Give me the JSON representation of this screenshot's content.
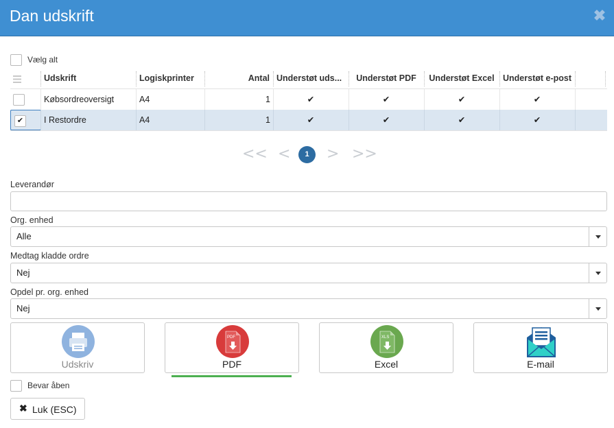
{
  "dialog": {
    "title": "Dan udskrift",
    "close_icon": "close-icon"
  },
  "select_all": {
    "label": "Vælg alt",
    "checked": false
  },
  "grid": {
    "columns": [
      "Udskrift",
      "Logiskprinter",
      "Antal",
      "Understøt uds...",
      "Understøt PDF",
      "Understøt Excel",
      "Understøt e-post"
    ],
    "rows": [
      {
        "checked": false,
        "name": "Købsordreoversigt",
        "printer": "A4",
        "count": "1",
        "uds": true,
        "pdf": true,
        "excel": true,
        "email": true
      },
      {
        "checked": true,
        "name": "I Restordre",
        "printer": "A4",
        "count": "1",
        "uds": true,
        "pdf": true,
        "excel": true,
        "email": true
      }
    ],
    "check_glyph": "✔",
    "row_checkbox_glyph": "✔",
    "column_menu_icon": "list-icon"
  },
  "pager": {
    "first": "<<",
    "prev": "<",
    "current": "1",
    "next": ">",
    "last": ">>"
  },
  "form": {
    "supplier": {
      "label": "Leverandør",
      "value": ""
    },
    "org_unit": {
      "label": "Org. enhed",
      "value": "Alle"
    },
    "draft_orders": {
      "label": "Medtag kladde ordre",
      "value": "Nej"
    },
    "split_org": {
      "label": "Opdel pr. org. enhed",
      "value": "Nej"
    }
  },
  "outputs": {
    "print": {
      "label": "Udskriv",
      "icon": "printer-icon",
      "color": "#8fb3df",
      "disabled": true
    },
    "pdf": {
      "label": "PDF",
      "icon": "pdf-file-icon",
      "color": "#d83b3b",
      "selected": true
    },
    "excel": {
      "label": "Excel",
      "icon": "excel-file-icon",
      "color": "#6aa84f"
    },
    "email": {
      "label": "E-mail",
      "icon": "envelope-icon",
      "color": "#1f5f9e"
    },
    "pdf_badge": "PDF",
    "xls_badge": "XLS"
  },
  "keep_open": {
    "label": "Bevar åben",
    "checked": false
  },
  "close_button": {
    "label": "Luk (ESC)",
    "icon": "close-icon"
  },
  "colors": {
    "header": "#3f8fd2",
    "selected_row": "#dbe6f1",
    "accent_underline": "#4caf50",
    "page_active": "#2d6ca2"
  }
}
